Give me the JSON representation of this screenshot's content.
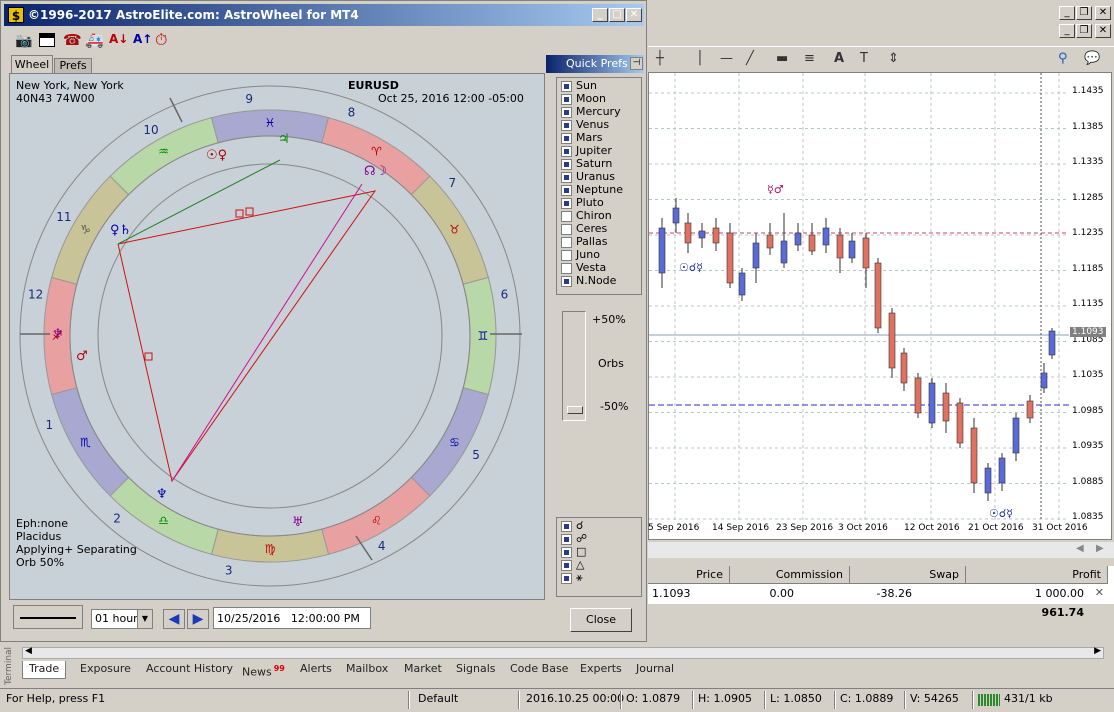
{
  "astro": {
    "title": "©1996-2017 AstroElite.com: AstroWheel for MT4",
    "tabs": [
      "Wheel",
      "Prefs"
    ],
    "location": "New York, New York",
    "coords": "40N43 74W00",
    "symbol": "EURUSD",
    "datetime": "Oct 25, 2016 12:00 -05:00",
    "info": [
      "Eph:none",
      "Placidus",
      "Applying+ Separating",
      "Orb 50%"
    ],
    "houses": [
      "1",
      "2",
      "3",
      "4",
      "5",
      "6",
      "7",
      "8",
      "9",
      "10",
      "11",
      "12"
    ],
    "quick_prefs_title": "Quick Prefs",
    "planets": [
      {
        "name": "Sun",
        "checked": true
      },
      {
        "name": "Moon",
        "checked": true
      },
      {
        "name": "Mercury",
        "checked": true
      },
      {
        "name": "Venus",
        "checked": true
      },
      {
        "name": "Mars",
        "checked": true
      },
      {
        "name": "Jupiter",
        "checked": true
      },
      {
        "name": "Saturn",
        "checked": true
      },
      {
        "name": "Uranus",
        "checked": true
      },
      {
        "name": "Neptune",
        "checked": true
      },
      {
        "name": "Pluto",
        "checked": true
      },
      {
        "name": "Chiron",
        "checked": false
      },
      {
        "name": "Ceres",
        "checked": false
      },
      {
        "name": "Pallas",
        "checked": false
      },
      {
        "name": "Juno",
        "checked": false
      },
      {
        "name": "Vesta",
        "checked": false
      },
      {
        "name": "N.Node",
        "checked": true
      }
    ],
    "orbs": {
      "top": "+50%",
      "mid": "Orbs",
      "bottom": "-50%"
    },
    "aspects": [
      "☌",
      "☍",
      "□",
      "△",
      "⚹"
    ],
    "timeframe": "01 hour",
    "date_input": "10/25/2016   12:00:00 PM",
    "close_label": "Close"
  },
  "chart": {
    "prices": [
      "1.1435",
      "1.1385",
      "1.1335",
      "1.1285",
      "1.1235",
      "1.1185",
      "1.1135",
      "1.1085",
      "1.1035",
      "1.0985",
      "1.0935",
      "1.0885",
      "1.0835"
    ],
    "current_price": "1.1093",
    "dates": [
      "5 Sep 2016",
      "14 Sep 2016",
      "23 Sep 2016",
      "3 Oct 2016",
      "12 Oct 2016",
      "21 Oct 2016",
      "31 Oct 2016"
    ]
  },
  "terminal": {
    "headers": {
      "price": "Price",
      "commission": "Commission",
      "swap": "Swap",
      "profit": "Profit"
    },
    "row": {
      "price": "1.1093",
      "commission": "0.00",
      "swap": "-38.26",
      "profit": "1 000.00"
    },
    "total": "961.74",
    "tabs": [
      "Trade",
      "Exposure",
      "Account History",
      "News",
      "Alerts",
      "Mailbox",
      "Market",
      "Signals",
      "Code Base",
      "Experts",
      "Journal"
    ],
    "news_badge": "99",
    "side_label": "Terminal"
  },
  "status": {
    "help": "For Help, press F1",
    "profile": "Default",
    "time": "2016.10.25 00:00",
    "open": "O: 1.0879",
    "high": "H: 1.0905",
    "low": "L: 1.0850",
    "close": "C: 1.0889",
    "volume": "V: 54265",
    "traffic": "431/1 kb"
  }
}
